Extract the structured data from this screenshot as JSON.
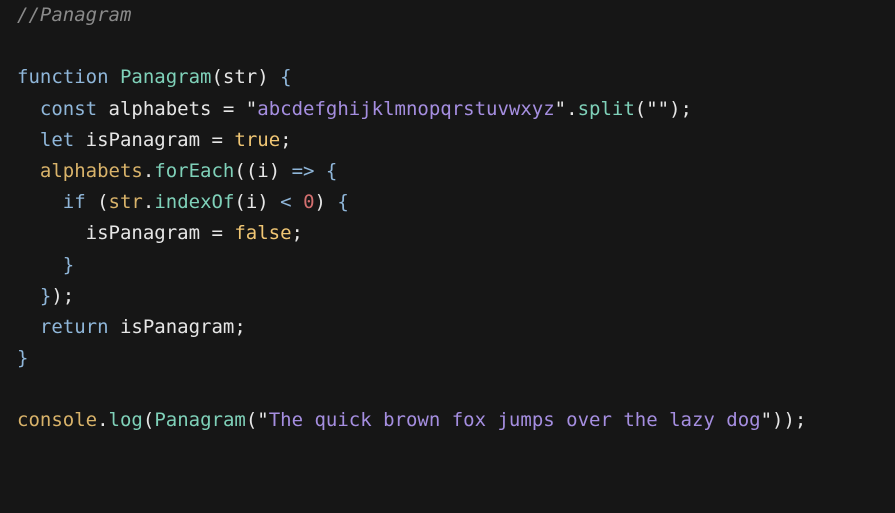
{
  "code": {
    "lines": [
      [
        {
          "t": "//Panagram",
          "c": "comment"
        }
      ],
      [],
      [
        {
          "t": "function",
          "c": "keyword"
        },
        {
          "t": " ",
          "c": "punct"
        },
        {
          "t": "Panagram",
          "c": "fn"
        },
        {
          "t": "(str) ",
          "c": "punct"
        },
        {
          "t": "{",
          "c": "brace"
        }
      ],
      [
        {
          "t": "  ",
          "c": "punct"
        },
        {
          "t": "const",
          "c": "keyword"
        },
        {
          "t": " alphabets = \"",
          "c": "ident"
        },
        {
          "t": "abcdefghijklmnopqrstuvwxyz",
          "c": "string"
        },
        {
          "t": "\".",
          "c": "ident"
        },
        {
          "t": "split",
          "c": "method"
        },
        {
          "t": "(\"\");",
          "c": "punct"
        }
      ],
      [
        {
          "t": "  ",
          "c": "punct"
        },
        {
          "t": "let",
          "c": "keyword"
        },
        {
          "t": " isPanagram = ",
          "c": "ident"
        },
        {
          "t": "true",
          "c": "boolean"
        },
        {
          "t": ";",
          "c": "punct"
        }
      ],
      [
        {
          "t": "  ",
          "c": "punct"
        },
        {
          "t": "alphabets",
          "c": "var"
        },
        {
          "t": ".",
          "c": "punct"
        },
        {
          "t": "forEach",
          "c": "method"
        },
        {
          "t": "((i) ",
          "c": "punct"
        },
        {
          "t": "=>",
          "c": "operator"
        },
        {
          "t": " ",
          "c": "punct"
        },
        {
          "t": "{",
          "c": "brace"
        }
      ],
      [
        {
          "t": "    ",
          "c": "punct"
        },
        {
          "t": "if",
          "c": "keyword"
        },
        {
          "t": " (",
          "c": "punct"
        },
        {
          "t": "str",
          "c": "var"
        },
        {
          "t": ".",
          "c": "punct"
        },
        {
          "t": "indexOf",
          "c": "method"
        },
        {
          "t": "(i) ",
          "c": "punct"
        },
        {
          "t": "<",
          "c": "operator"
        },
        {
          "t": " ",
          "c": "punct"
        },
        {
          "t": "0",
          "c": "number"
        },
        {
          "t": ") ",
          "c": "punct"
        },
        {
          "t": "{",
          "c": "brace"
        }
      ],
      [
        {
          "t": "      isPanagram = ",
          "c": "ident"
        },
        {
          "t": "false",
          "c": "boolean"
        },
        {
          "t": ";",
          "c": "punct"
        }
      ],
      [
        {
          "t": "    ",
          "c": "punct"
        },
        {
          "t": "}",
          "c": "brace"
        }
      ],
      [
        {
          "t": "  ",
          "c": "punct"
        },
        {
          "t": "}",
          "c": "brace"
        },
        {
          "t": ");",
          "c": "punct"
        }
      ],
      [
        {
          "t": "  ",
          "c": "punct"
        },
        {
          "t": "return",
          "c": "keyword"
        },
        {
          "t": " isPanagram;",
          "c": "ident"
        }
      ],
      [
        {
          "t": "}",
          "c": "brace"
        }
      ],
      [],
      [
        {
          "t": "console",
          "c": "var"
        },
        {
          "t": ".",
          "c": "punct"
        },
        {
          "t": "log",
          "c": "method"
        },
        {
          "t": "(",
          "c": "punct"
        },
        {
          "t": "Panagram",
          "c": "fn"
        },
        {
          "t": "(\"",
          "c": "punct"
        },
        {
          "t": "The quick brown fox jumps over the lazy dog",
          "c": "string"
        },
        {
          "t": "\"));",
          "c": "punct"
        }
      ]
    ]
  },
  "colors": {
    "background": "#161616",
    "comment": "#8a8a8a",
    "keyword": "#8fb6d9",
    "function_name": "#7fd1b9",
    "string": "#a58ee0",
    "boolean": "#f0c674",
    "number": "#d36f6f",
    "variable": "#d9b36a"
  }
}
